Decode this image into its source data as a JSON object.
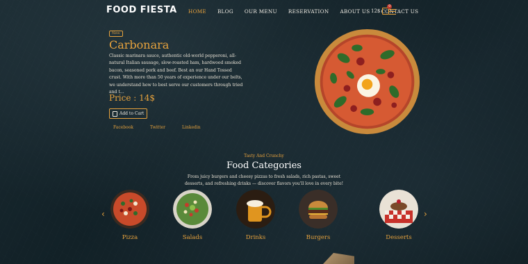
{
  "brand": {
    "logo": "FOOD FIESTA"
  },
  "nav": {
    "items": [
      {
        "label": "HOME",
        "active": true
      },
      {
        "label": "BLOG",
        "active": false
      },
      {
        "label": "OUR MENU",
        "active": false
      },
      {
        "label": "RESERVATION",
        "active": false
      },
      {
        "label": "ABOUT US",
        "active": false
      },
      {
        "label": "CONTACT US",
        "active": false
      }
    ],
    "cart_total": "12$",
    "cart_count": "0"
  },
  "hero": {
    "tag": "New",
    "title": "Carbonara",
    "description": "Classic marinara sauce, authentic old-world pepperoni, all-natural Italian sausage, slow-roasted ham, hardwood smoked bacon, seasoned pork and beef. Best an our Hand Tossed crust. With more than 50 years of experience under our belts, we understand how to best serve our customers through tried and t...",
    "price": "Price : 14$",
    "add_to_cart": "Add to Cart",
    "socials": [
      "Facebook",
      "Twitter",
      "Linkedin"
    ]
  },
  "categories": {
    "subtitle": "Tasty And Crunchy",
    "title": "Food Categories",
    "description": "From juicy burgers and cheesy pizzas to fresh salads, rich pastas, sweet desserts, and refreshing drinks — discover flavors you'll love in every bite!",
    "items": [
      {
        "label": "Pizza",
        "icon": "pizza-icon"
      },
      {
        "label": "Salads",
        "icon": "salad-icon"
      },
      {
        "label": "Drinks",
        "icon": "beer-icon"
      },
      {
        "label": "Burgers",
        "icon": "burger-icon"
      },
      {
        "label": "Desserts",
        "icon": "dessert-icon"
      }
    ],
    "prev_arrow": "‹",
    "next_arrow": "›"
  },
  "colors": {
    "accent": "#e8a33d",
    "background": "#142329",
    "text": "#e9e3d6"
  }
}
